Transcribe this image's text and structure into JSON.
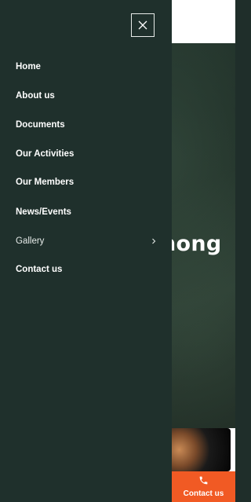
{
  "background": {
    "hero_text": "hong",
    "contact_button": {
      "icon": "phone-icon",
      "label": "Contact us"
    }
  },
  "drawer": {
    "close_icon": "close-icon",
    "menu": [
      {
        "label": "Home"
      },
      {
        "label": "About us"
      },
      {
        "label": "Documents"
      },
      {
        "label": "Our Activities"
      },
      {
        "label": "Our Members"
      },
      {
        "label": "News/Events"
      },
      {
        "label": "Gallery",
        "has_submenu": true
      },
      {
        "label": "Contact us"
      }
    ]
  },
  "colors": {
    "drawer_bg": "#1f302c",
    "accent": "#f15a24",
    "text": "#ffffff"
  }
}
